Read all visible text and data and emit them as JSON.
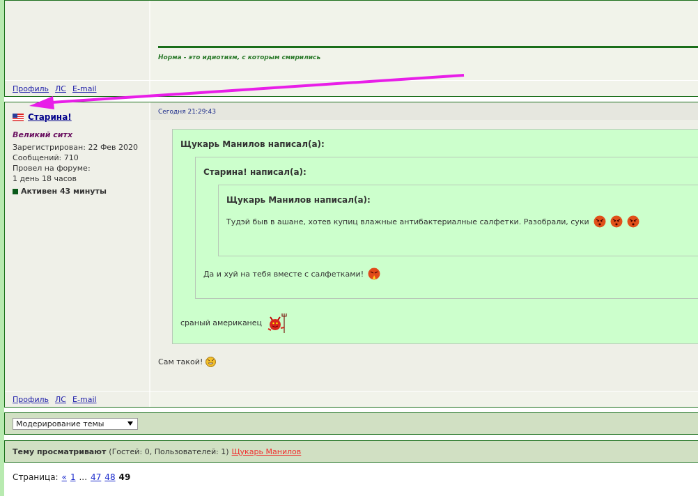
{
  "previous_post": {
    "signature": "Норма - это идиотизм, с которым смирились",
    "links": [
      "Профиль",
      "ЛС",
      "E-mail"
    ]
  },
  "post": {
    "author": "Старина!",
    "rank": "Великий ситх",
    "info": [
      "Зарегистрирован: 22 Фев 2020",
      "Сообщений: 710",
      "Провел на форуме:",
      "1 день 18 часов"
    ],
    "activity": "Активен 43 минуты",
    "date": "Сегодня 21:29:43",
    "quote": {
      "header": "Щукарь Манилов написал(а):",
      "text": "сраный американец",
      "quote": {
        "header": "Старина! написал(а):",
        "text": "Да и хуй на тебя вместе с салфетками!",
        "quote": {
          "header": "Щукарь Манилов написал(а):",
          "text": "Тудэй быв в ашане, хотев купиц влажные антибактериалные салфетки. Разобрали, суки"
        }
      }
    },
    "reply": "Сам такой!",
    "links": [
      "Профиль",
      "ЛС",
      "E-mail"
    ]
  },
  "moderation": {
    "value": "Модерирование темы"
  },
  "viewers": {
    "label": "Тему просматривают",
    "counts": "(Гостей: 0, Пользователей: 1)",
    "users": [
      "Щукарь Манилов"
    ]
  },
  "pagination": {
    "label": "Страница:",
    "items": [
      {
        "text": "«",
        "kind": "link",
        "selected": false
      },
      {
        "text": "1",
        "kind": "link",
        "selected": false
      },
      {
        "text": "...",
        "kind": "gap"
      },
      {
        "text": "47",
        "kind": "link",
        "selected": false
      },
      {
        "text": "48",
        "kind": "link",
        "selected": false
      },
      {
        "text": "49",
        "kind": "link",
        "selected": true
      }
    ]
  }
}
